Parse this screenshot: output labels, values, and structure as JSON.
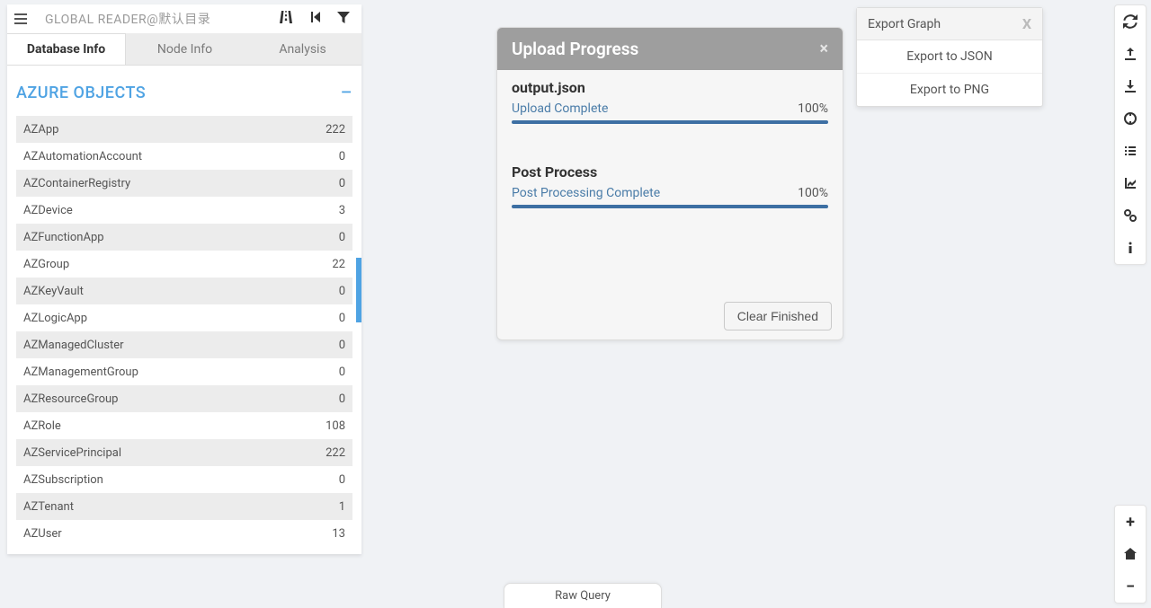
{
  "header": {
    "title": "GLOBAL READER@默认目录"
  },
  "tabs": [
    {
      "label": "Database Info",
      "active": true
    },
    {
      "label": "Node Info",
      "active": false
    },
    {
      "label": "Analysis",
      "active": false
    }
  ],
  "section": {
    "title": "AZURE OBJECTS"
  },
  "objects": [
    {
      "name": "AZApp",
      "count": "222"
    },
    {
      "name": "AZAutomationAccount",
      "count": "0"
    },
    {
      "name": "AZContainerRegistry",
      "count": "0"
    },
    {
      "name": "AZDevice",
      "count": "3"
    },
    {
      "name": "AZFunctionApp",
      "count": "0"
    },
    {
      "name": "AZGroup",
      "count": "22"
    },
    {
      "name": "AZKeyVault",
      "count": "0"
    },
    {
      "name": "AZLogicApp",
      "count": "0"
    },
    {
      "name": "AZManagedCluster",
      "count": "0"
    },
    {
      "name": "AZManagementGroup",
      "count": "0"
    },
    {
      "name": "AZResourceGroup",
      "count": "0"
    },
    {
      "name": "AZRole",
      "count": "108"
    },
    {
      "name": "AZServicePrincipal",
      "count": "222"
    },
    {
      "name": "AZSubscription",
      "count": "0"
    },
    {
      "name": "AZTenant",
      "count": "1"
    },
    {
      "name": "AZUser",
      "count": "13"
    }
  ],
  "upload": {
    "title": "Upload Progress",
    "file": "output.json",
    "upload_status": "Upload Complete",
    "upload_pct": "100%",
    "post_title": "Post Process",
    "post_status": "Post Processing Complete",
    "post_pct": "100%",
    "clear_label": "Clear Finished"
  },
  "export": {
    "title": "Export Graph",
    "items": [
      "Export to JSON",
      "Export to PNG"
    ]
  },
  "raw_query_label": "Raw Query"
}
